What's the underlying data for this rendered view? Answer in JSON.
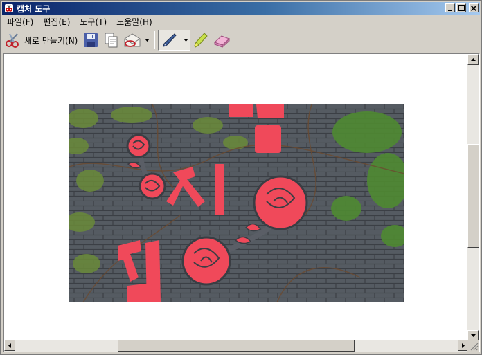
{
  "window": {
    "title": "캡처 도구",
    "controls": {
      "minimize": "minimize",
      "maximize": "maximize",
      "close": "close"
    }
  },
  "menu": [
    {
      "label": "파일(F)"
    },
    {
      "label": "편집(E)"
    },
    {
      "label": "도구(T)"
    },
    {
      "label": "도움말(H)"
    }
  ],
  "toolbar": {
    "new_label": "새로 만들기(N)",
    "icons": {
      "new": "scissors-icon",
      "save": "floppy-disk-icon",
      "copy": "copy-icon",
      "send": "email-icon",
      "pen": "pen-icon",
      "highlighter": "highlighter-icon",
      "eraser": "eraser-icon"
    }
  },
  "colors": {
    "title_start": "#0a246a",
    "title_end": "#a6caf0",
    "chrome": "#d4d0c8",
    "sign_red": "#f0495a"
  },
  "capture": {
    "visible_text": [
      "봄",
      "지",
      "길"
    ]
  }
}
